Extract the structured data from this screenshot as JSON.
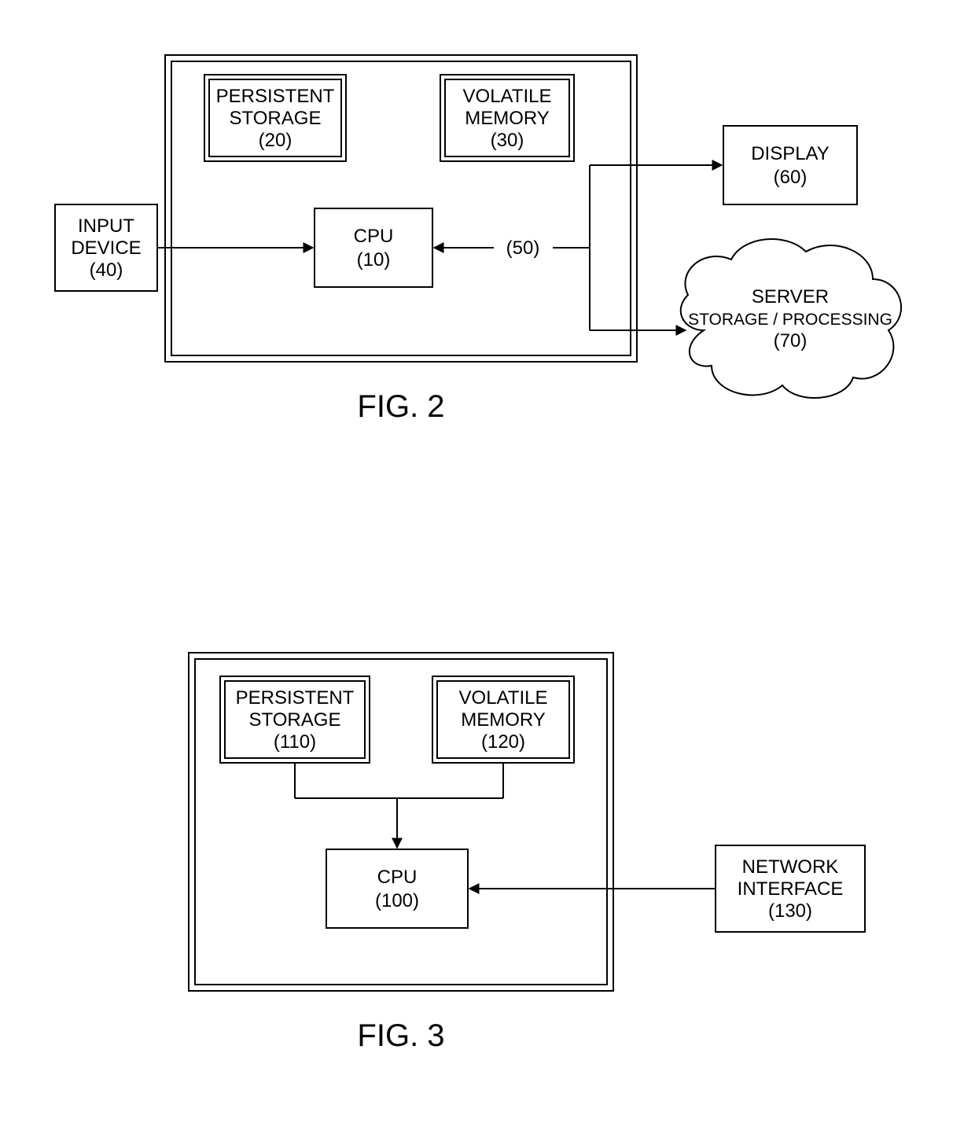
{
  "fig2": {
    "caption": "FIG. 2",
    "persistent_storage": {
      "line1": "PERSISTENT",
      "line2": "STORAGE",
      "line3": "(20)"
    },
    "volatile_memory": {
      "line1": "VOLATILE",
      "line2": "MEMORY",
      "line3": "(30)"
    },
    "cpu": {
      "line1": "CPU",
      "line2": "(10)"
    },
    "input_device": {
      "line1": "INPUT",
      "line2": "DEVICE",
      "line3": "(40)"
    },
    "display": {
      "line1": "DISPLAY",
      "line2": "(60)"
    },
    "server": {
      "line1": "SERVER",
      "line2": "STORAGE / PROCESSING",
      "line3": "(70)"
    },
    "link_label": "(50)"
  },
  "fig3": {
    "caption": "FIG. 3",
    "persistent_storage": {
      "line1": "PERSISTENT",
      "line2": "STORAGE",
      "line3": "(110)"
    },
    "volatile_memory": {
      "line1": "VOLATILE",
      "line2": "MEMORY",
      "line3": "(120)"
    },
    "cpu": {
      "line1": "CPU",
      "line2": "(100)"
    },
    "network_interface": {
      "line1": "NETWORK",
      "line2": "INTERFACE",
      "line3": "(130)"
    }
  }
}
